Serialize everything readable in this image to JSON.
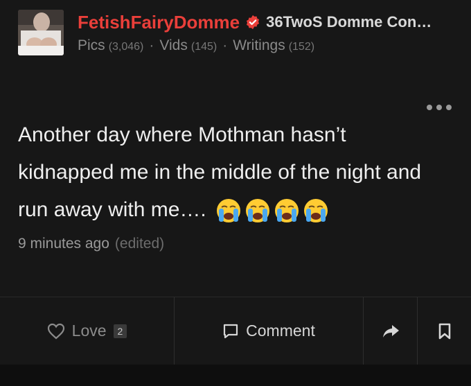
{
  "profile": {
    "username": "FetishFairyDomme",
    "verified_icon": "verified-check-badge",
    "group_name": "36TwoS Domme Con…",
    "stats": [
      {
        "label": "Pics",
        "count": "(3,046)"
      },
      {
        "label": "Vids",
        "count": "(145)"
      },
      {
        "label": "Writings",
        "count": "(152)"
      }
    ]
  },
  "post": {
    "text": "Another day where Mothman hasn’t kidnapped me in the middle of the night and run away with me….",
    "emojis": [
      "loudly-crying-face",
      "loudly-crying-face",
      "loudly-crying-face",
      "loudly-crying-face"
    ],
    "time": "9 minutes ago",
    "edited": "(edited)"
  },
  "actions": {
    "love_label": "Love",
    "love_count": "2",
    "comment_label": "Comment"
  },
  "colors": {
    "username": "#ea3f3a",
    "background": "#0e0e0e",
    "card": "#171717"
  }
}
